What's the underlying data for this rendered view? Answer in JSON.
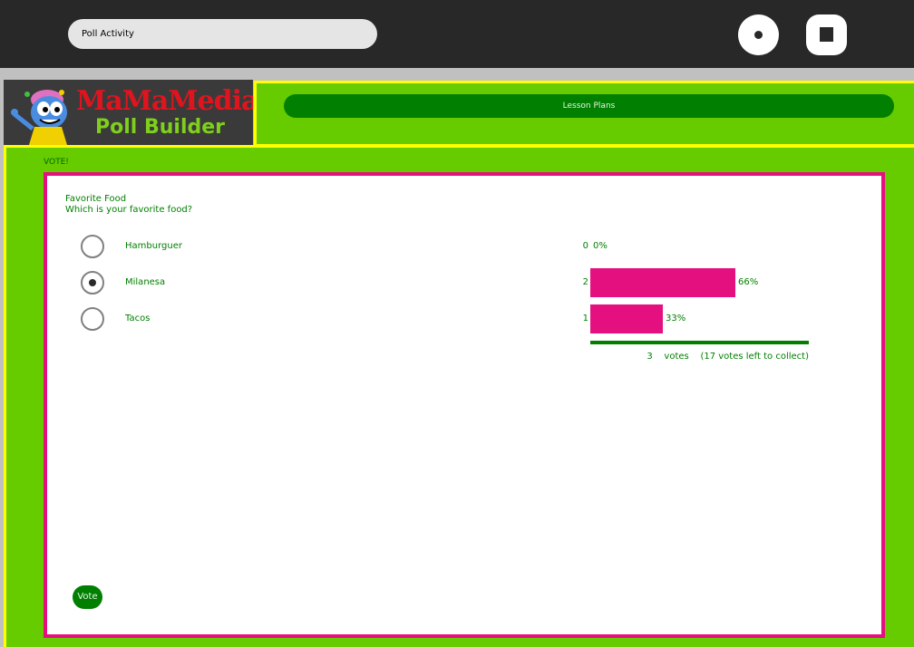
{
  "toolbar": {
    "activity_title": "Poll Activity",
    "record_icon": "record-icon",
    "stop_icon": "stop-icon"
  },
  "header": {
    "logo_brand": "MaMaMedia",
    "logo_subtitle": "Poll Builder",
    "lesson_plans_label": "Lesson Plans"
  },
  "main": {
    "vote_heading": "VOTE!",
    "poll": {
      "title": "Favorite Food",
      "question": "Which is your favorite food?",
      "choices": [
        {
          "label": "Hamburguer",
          "votes": "0",
          "percent": "0%",
          "fraction": 0.0,
          "selected": false
        },
        {
          "label": "Milanesa",
          "votes": "2",
          "percent": "66%",
          "fraction": 0.667,
          "selected": true
        },
        {
          "label": "Tacos",
          "votes": "1",
          "percent": "33%",
          "fraction": 0.333,
          "selected": false
        }
      ],
      "total_votes": "3",
      "votes_word": "votes",
      "votes_left": "(17 votes left to collect)"
    },
    "vote_button_label": "Vote"
  },
  "colors": {
    "toolbar_bg": "#282828",
    "band_green": "#66cc00",
    "band_border_yellow": "#ffff00",
    "accent_dark_green": "#007f00",
    "poll_border_magenta": "#e5107f",
    "bar_magenta": "#e5107f"
  }
}
